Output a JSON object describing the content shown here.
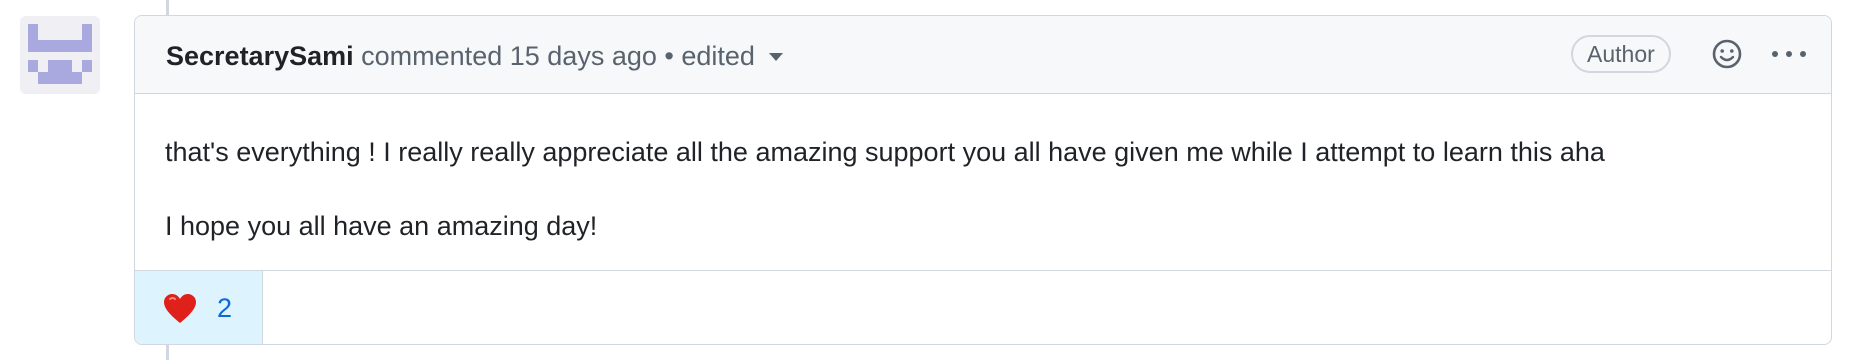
{
  "comment": {
    "author": "SecretarySami",
    "action": "commented",
    "time": "15 days ago",
    "separator": "•",
    "edited": "edited",
    "badge": "Author",
    "body": [
      "that's everything ! I really really appreciate all the amazing support you all have given me while I attempt to learn this aha",
      "I hope you all have an amazing day!"
    ],
    "reactions": [
      {
        "icon": "heart-icon",
        "count": "2"
      }
    ]
  },
  "colors": {
    "accent": "#0969da",
    "reaction_bg": "#ddf4ff",
    "avatar_pattern": "#a9a9e0"
  }
}
